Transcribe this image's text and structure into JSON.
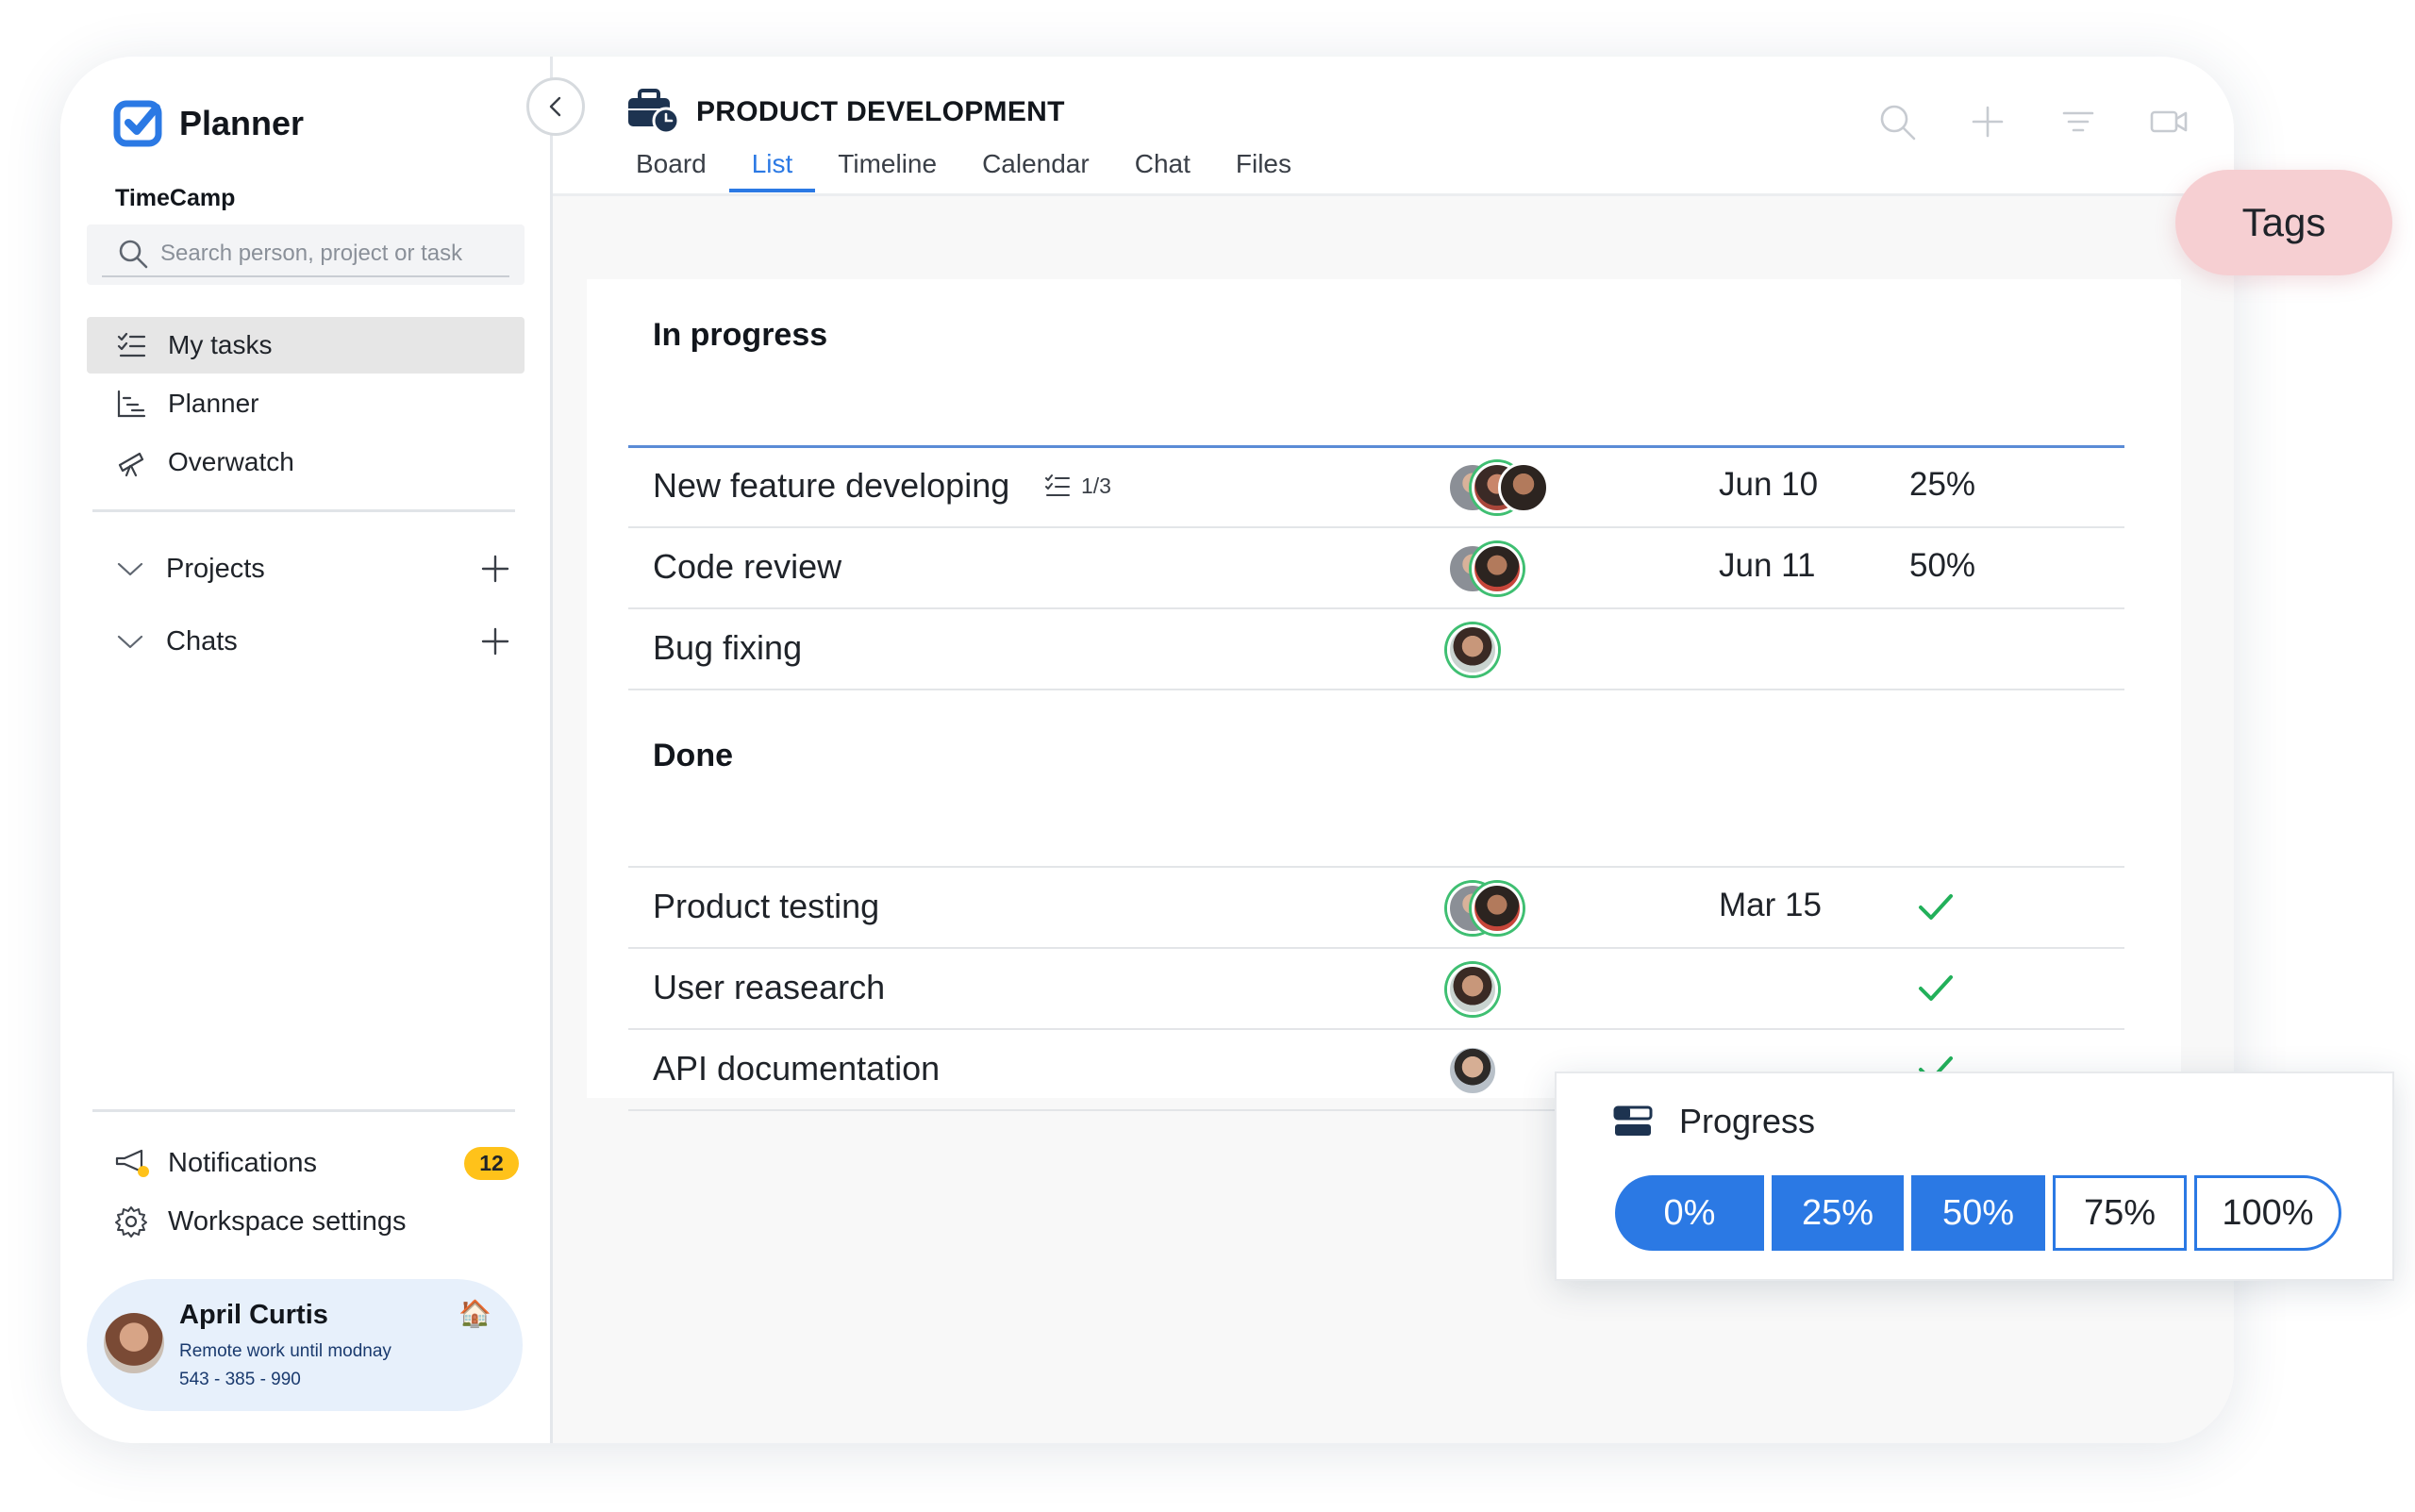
{
  "app": {
    "name": "Planner",
    "workspace": "TimeCamp"
  },
  "search": {
    "placeholder": "Search person, project or task"
  },
  "nav": [
    {
      "label": "My tasks",
      "icon": "task-list-icon",
      "active": true
    },
    {
      "label": "Planner",
      "icon": "planner-chart-icon",
      "active": false
    },
    {
      "label": "Overwatch",
      "icon": "telescope-icon",
      "active": false
    }
  ],
  "sections": [
    {
      "label": "Projects"
    },
    {
      "label": "Chats"
    }
  ],
  "bottom": {
    "notifications_label": "Notifications",
    "notifications_count": "12",
    "settings_label": "Workspace settings"
  },
  "user": {
    "name": "April Curtis",
    "status": "Remote work until modnay",
    "phone": "543 - 385 - 990",
    "status_icon": "🏠"
  },
  "project": {
    "title": "PRODUCT DEVELOPMENT",
    "tabs": [
      "Board",
      "List",
      "Timeline",
      "Calendar",
      "Chat",
      "Files"
    ],
    "active_tab": "List"
  },
  "groups": {
    "in_progress": {
      "title": "In progress",
      "tasks": [
        {
          "name": "New feature developing",
          "subtasks": "1/3",
          "date": "Jun 10",
          "progress": "25%"
        },
        {
          "name": "Code review",
          "date": "Jun 11",
          "progress": "50%"
        },
        {
          "name": "Bug fixing"
        }
      ]
    },
    "done": {
      "title": "Done",
      "tasks": [
        {
          "name": "Product testing",
          "date": "Mar 15",
          "done": true
        },
        {
          "name": "User reasearch",
          "done": true
        },
        {
          "name": "API documentation",
          "done": true
        }
      ]
    }
  },
  "tags_label": "Tags",
  "progress_popup": {
    "title": "Progress",
    "options": [
      "0%",
      "25%",
      "50%",
      "75%",
      "100%"
    ],
    "selected_up_to": "50%"
  },
  "colors": {
    "accent": "#2b79e4",
    "badge": "#ffc21a",
    "check": "#22b05a",
    "tags_bg": "#f6cfd2",
    "user_card_bg": "#e7f0fb"
  }
}
